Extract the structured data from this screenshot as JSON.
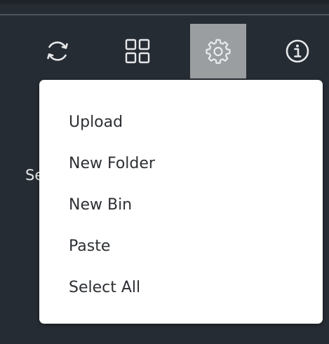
{
  "toolbar": {
    "buttons": [
      {
        "icon": "refresh-icon",
        "active": false
      },
      {
        "icon": "grid-view-icon",
        "active": false
      },
      {
        "icon": "gear-icon",
        "active": true
      },
      {
        "icon": "info-icon",
        "active": false
      }
    ]
  },
  "background": {
    "partial_text": "Se"
  },
  "settings_menu": {
    "items": [
      {
        "label": "Upload"
      },
      {
        "label": "New Folder"
      },
      {
        "label": "New Bin"
      },
      {
        "label": "Paste"
      },
      {
        "label": "Select All"
      }
    ]
  },
  "colors": {
    "toolbar_bg": "#262c33",
    "active_button_bg": "#9b9ea1",
    "icon_color": "#e6e8ea",
    "menu_bg": "#ffffff",
    "menu_text": "#2c2f33"
  }
}
